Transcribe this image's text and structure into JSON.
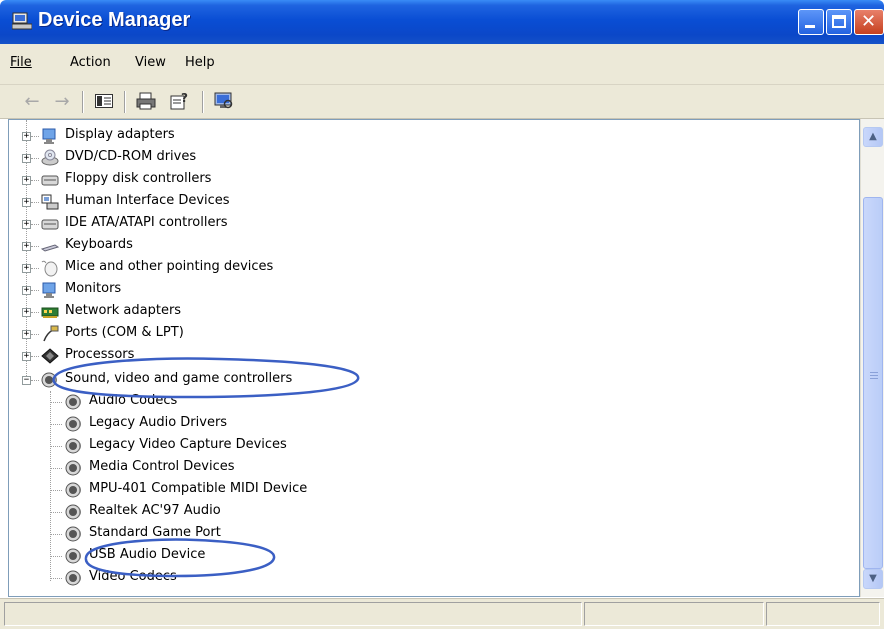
{
  "window": {
    "title": "Device Manager"
  },
  "menu": [
    {
      "key": "file",
      "label": "File"
    },
    {
      "key": "action",
      "label": "Action"
    },
    {
      "key": "view",
      "label": "View"
    },
    {
      "key": "help",
      "label": "Help"
    }
  ],
  "tree": {
    "categories": [
      {
        "label": "Display adapters",
        "icon": "display-adapter-icon",
        "expanded": false
      },
      {
        "label": "DVD/CD-ROM drives",
        "icon": "cdrom-icon",
        "expanded": false
      },
      {
        "label": "Floppy disk controllers",
        "icon": "floppy-controller-icon",
        "expanded": false
      },
      {
        "label": "Human Interface Devices",
        "icon": "hid-icon",
        "expanded": false
      },
      {
        "label": "IDE ATA/ATAPI controllers",
        "icon": "ide-controller-icon",
        "expanded": false
      },
      {
        "label": "Keyboards",
        "icon": "keyboard-icon",
        "expanded": false
      },
      {
        "label": "Mice and other pointing devices",
        "icon": "mouse-icon",
        "expanded": false
      },
      {
        "label": "Monitors",
        "icon": "monitor-icon",
        "expanded": false
      },
      {
        "label": "Network adapters",
        "icon": "network-adapter-icon",
        "expanded": false
      },
      {
        "label": "Ports (COM & LPT)",
        "icon": "port-icon",
        "expanded": false
      },
      {
        "label": "Processors",
        "icon": "processor-icon",
        "expanded": false
      },
      {
        "label": "Sound, video and game controllers",
        "icon": "sound-icon",
        "expanded": true
      }
    ],
    "sound_children": [
      {
        "label": "Audio Codecs"
      },
      {
        "label": "Legacy Audio Drivers"
      },
      {
        "label": "Legacy Video Capture Devices"
      },
      {
        "label": "Media Control Devices"
      },
      {
        "label": "MPU-401 Compatible MIDI Device"
      },
      {
        "label": "Realtek AC'97 Audio"
      },
      {
        "label": "Standard Game Port"
      },
      {
        "label": "USB Audio Device"
      },
      {
        "label": "Video Codecs"
      }
    ]
  },
  "colors": {
    "annotation": "#3b5fc4",
    "titlebar": "#0b4fd4"
  }
}
